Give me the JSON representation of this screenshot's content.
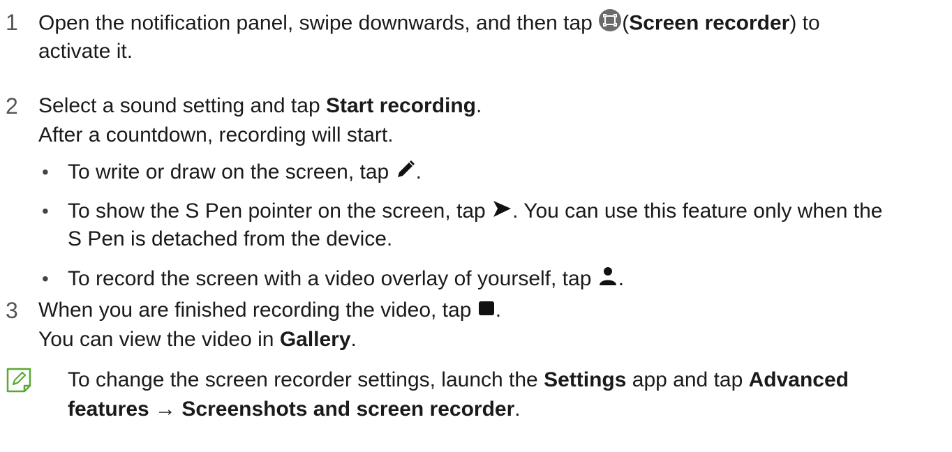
{
  "steps": [
    {
      "number": "1",
      "line1_pre": "Open the notification panel, swipe downwards, and then tap",
      "line1_open": "(",
      "line1_bold": "Screen recorder",
      "line1_post": ") to",
      "line2": "activate it.",
      "icon": "screen-recorder-icon"
    },
    {
      "number": "2",
      "line1_pre": "Select a sound setting and tap",
      "line1_bold": "Start recording",
      "line1_post": ".",
      "line2": "After a countdown, recording will start.",
      "bullets": [
        {
          "symbol": "•",
          "pre": "To write or draw on the screen, tap",
          "post": ".",
          "icon": "pen-icon"
        },
        {
          "symbol": "•",
          "pre": "To show the S Pen pointer on the screen, tap",
          "post": ". You can use this feature only when the",
          "line2": "S Pen is detached from the device.",
          "icon": "pointer-icon"
        },
        {
          "symbol": "•",
          "pre": "To record the screen with a video overlay of yourself, tap",
          "post": ".",
          "icon": "person-icon"
        }
      ]
    },
    {
      "number": "3",
      "line1_pre": "When you are finished recording the video, tap",
      "line1_post": ".",
      "line2_pre": "You can view the video in",
      "line2_bold": "Gallery",
      "line2_post": ".",
      "icon": "stop-icon"
    }
  ],
  "note": {
    "icon": "note-icon",
    "accent_color": "#5aa832",
    "line1_pre": "To change the screen recorder settings, launch the",
    "line1_bold1": "Settings",
    "line1_mid": "app and tap",
    "line1_bold2": "Advanced",
    "line2_bold": "features → Screenshots and screen recorder",
    "line2_post": "."
  }
}
